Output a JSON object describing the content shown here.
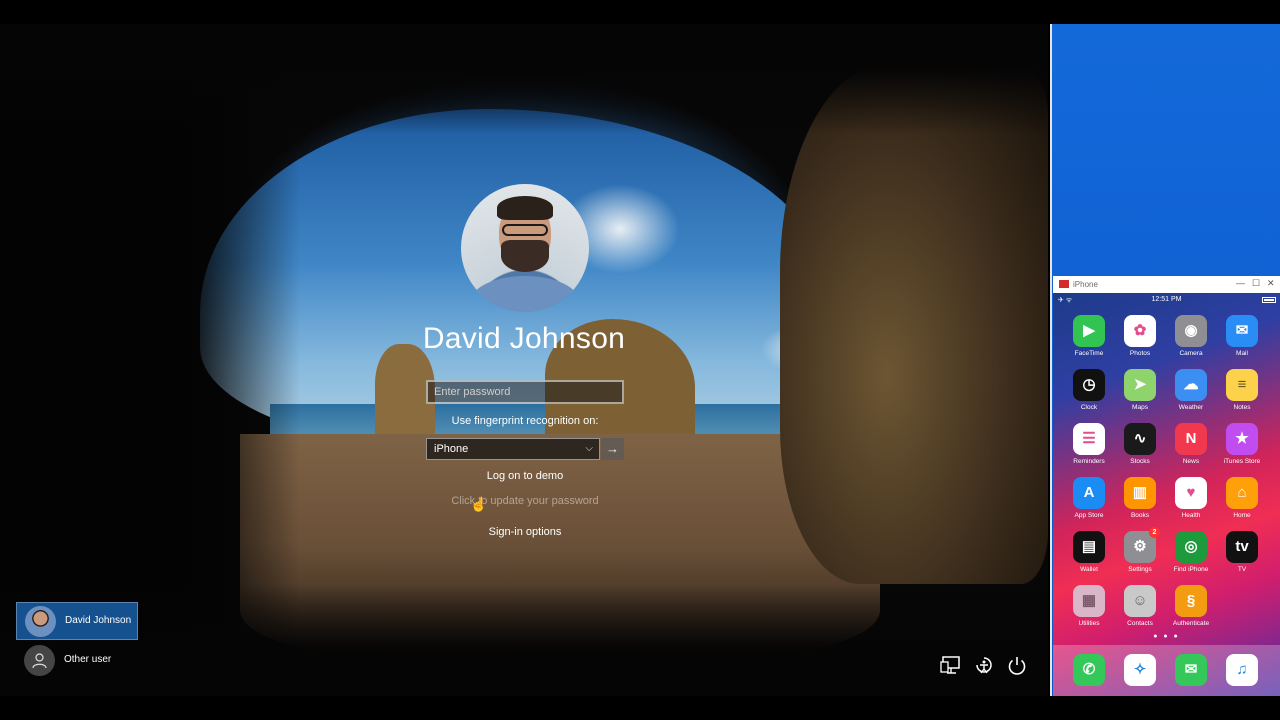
{
  "login": {
    "username": "David Johnson",
    "password_placeholder": "Enter password",
    "fingerprint_label": "Use fingerprint recognition on:",
    "device_selected": "iPhone",
    "logon_link": "Log on to demo",
    "update_password": "Click to update your password",
    "signin_options": "Sign-in options"
  },
  "user_switcher": [
    {
      "name": "David Johnson",
      "selected": true
    },
    {
      "name": "Other user",
      "selected": false
    }
  ],
  "system_icons": [
    "network-icon",
    "ease-of-access-icon",
    "power-icon"
  ],
  "iphone_window": {
    "title": "iPhone",
    "statusbar": {
      "time": "12:51 PM"
    },
    "apps": [
      {
        "label": "FaceTime",
        "icon": "facetime-icon",
        "glyph": "▶",
        "color": "#31c452"
      },
      {
        "label": "Photos",
        "icon": "photos-icon",
        "glyph": "✿",
        "color": "#ffffff"
      },
      {
        "label": "Camera",
        "icon": "camera-icon",
        "glyph": "◉",
        "color": "#8e8e93"
      },
      {
        "label": "Mail",
        "icon": "mail-icon",
        "glyph": "✉",
        "color": "#2a8cf5"
      },
      {
        "label": "Clock",
        "icon": "clock-icon",
        "glyph": "◷",
        "color": "#111111"
      },
      {
        "label": "Maps",
        "icon": "maps-icon",
        "glyph": "➤",
        "color": "#8fd36d"
      },
      {
        "label": "Weather",
        "icon": "weather-icon",
        "glyph": "☁",
        "color": "#3b8ff2"
      },
      {
        "label": "Notes",
        "icon": "notes-icon",
        "glyph": "≡",
        "color": "#fbd24a"
      },
      {
        "label": "Reminders",
        "icon": "reminders-icon",
        "glyph": "☰",
        "color": "#ffffff"
      },
      {
        "label": "Stocks",
        "icon": "stocks-icon",
        "glyph": "∿",
        "color": "#1a1a1a"
      },
      {
        "label": "News",
        "icon": "news-icon",
        "glyph": "N",
        "color": "#f2384f"
      },
      {
        "label": "iTunes Store",
        "icon": "itunes-store-icon",
        "glyph": "★",
        "color": "#c14cf0"
      },
      {
        "label": "App Store",
        "icon": "app-store-icon",
        "glyph": "A",
        "color": "#1b8cf3"
      },
      {
        "label": "Books",
        "icon": "books-icon",
        "glyph": "▥",
        "color": "#ff9500"
      },
      {
        "label": "Health",
        "icon": "health-icon",
        "glyph": "♥",
        "color": "#ffffff"
      },
      {
        "label": "Home",
        "icon": "home-icon",
        "glyph": "⌂",
        "color": "#ff9f0a"
      },
      {
        "label": "Wallet",
        "icon": "wallet-icon",
        "glyph": "▤",
        "color": "#111111"
      },
      {
        "label": "Settings",
        "icon": "settings-icon",
        "glyph": "⚙",
        "color": "#8e8e93",
        "badge": "2"
      },
      {
        "label": "Find iPhone",
        "icon": "find-iphone-icon",
        "glyph": "◎",
        "color": "#1d9a3c"
      },
      {
        "label": "TV",
        "icon": "tv-icon",
        "glyph": "tv",
        "color": "#111111"
      },
      {
        "label": "Utilities",
        "icon": "utilities-folder-icon",
        "glyph": "▦",
        "color": "#d9b6c8"
      },
      {
        "label": "Contacts",
        "icon": "contacts-icon",
        "glyph": "☺",
        "color": "#c9c9c9"
      },
      {
        "label": "Authenticate",
        "icon": "authenticate-icon",
        "glyph": "§",
        "color": "#f39c12"
      }
    ],
    "page_dots": "● ● ●",
    "dock": [
      {
        "icon": "phone-icon",
        "glyph": "✆",
        "color": "#34c759"
      },
      {
        "icon": "safari-icon",
        "glyph": "✧",
        "color": "#ffffff"
      },
      {
        "icon": "messages-icon",
        "glyph": "✉",
        "color": "#34c759"
      },
      {
        "icon": "music-icon",
        "glyph": "♫",
        "color": "#ffffff"
      }
    ]
  }
}
